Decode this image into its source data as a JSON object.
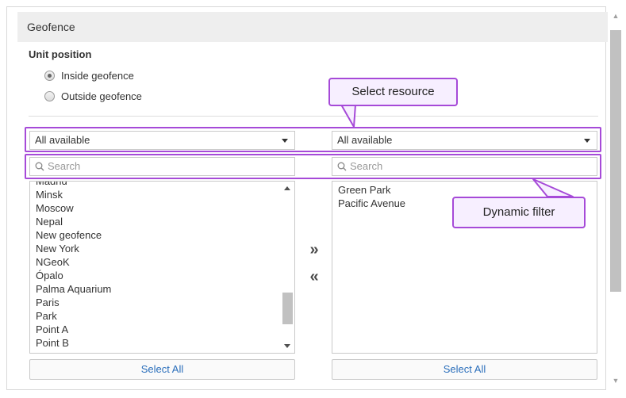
{
  "section": {
    "title": "Geofence"
  },
  "unit_position": {
    "label": "Unit position",
    "options": [
      {
        "label": "Inside geofence",
        "checked": true
      },
      {
        "label": "Outside geofence",
        "checked": false
      }
    ]
  },
  "left": {
    "select_value": "All available",
    "search_placeholder": "Search",
    "items": [
      "Madrid",
      "Minsk",
      "Moscow",
      "Nepal",
      "New geofence",
      "New York",
      "NGeoK",
      "Ópalo",
      "Palma Aquarium",
      "Paris",
      "Park",
      "Point A",
      "Point B"
    ],
    "select_all_label": "Select All"
  },
  "right": {
    "select_value": "All available",
    "search_placeholder": "Search",
    "items": [
      "Green Park",
      "Pacific Avenue"
    ],
    "select_all_label": "Select All"
  },
  "move": {
    "add_symbol": "»",
    "remove_symbol": "«"
  },
  "callouts": {
    "select_resource": "Select resource",
    "dynamic_filter": "Dynamic filter"
  },
  "colors": {
    "highlight": "#a64ad8",
    "link": "#2a6ebb"
  }
}
